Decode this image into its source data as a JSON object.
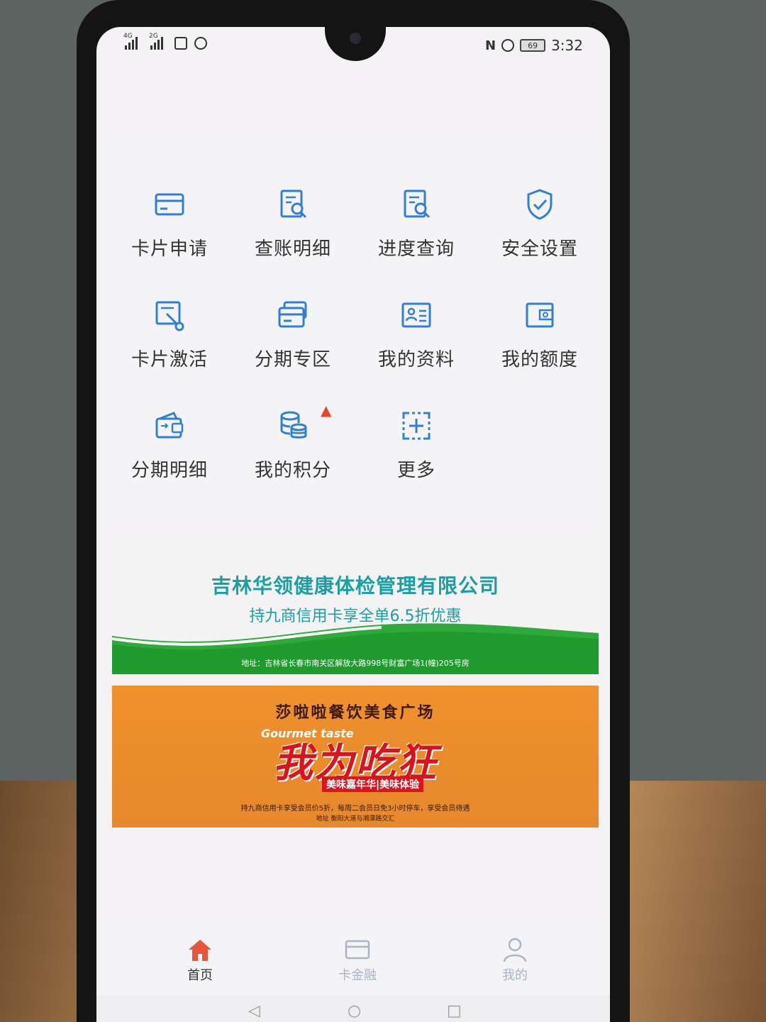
{
  "status_bar": {
    "signal1_tag": "4G",
    "signal2_tag": "2G",
    "battery": "69",
    "time": "3:32"
  },
  "menu": {
    "items": [
      {
        "label": "卡片申请",
        "icon": "card-icon"
      },
      {
        "label": "查账明细",
        "icon": "bill-search-icon"
      },
      {
        "label": "进度查询",
        "icon": "progress-search-icon"
      },
      {
        "label": "安全设置",
        "icon": "shield-check-icon"
      },
      {
        "label": "卡片激活",
        "icon": "card-activate-icon"
      },
      {
        "label": "分期专区",
        "icon": "installment-card-icon"
      },
      {
        "label": "我的资料",
        "icon": "profile-card-icon"
      },
      {
        "label": "我的额度",
        "icon": "wallet-icon"
      },
      {
        "label": "分期明细",
        "icon": "installment-wallet-icon"
      },
      {
        "label": "我的积分",
        "icon": "coins-icon"
      },
      {
        "label": "更多",
        "icon": "more-plus-icon"
      }
    ],
    "hot_badge": "fire-icon"
  },
  "banners": {
    "health": {
      "title": "吉林华领健康体检管理有限公司",
      "subtitle": "持九商信用卡享全单6.5折优惠",
      "address": "地址：吉林省长春市南关区解放大路998号财富广场1(幢)205号房"
    },
    "food": {
      "title": "莎啦啦餐饮美食广场",
      "english": "Gourmet taste",
      "headline": "我为吃狂",
      "tag": "美味嘉年华|美味体验",
      "description": "持九商信用卡享受会员价5折，每周二会员日免3小时停车，享受会员待遇",
      "address": "地址 衡阳大道与湘潭路交汇"
    }
  },
  "bottom_nav": {
    "items": [
      {
        "label": "首页",
        "icon": "home-icon",
        "active": true
      },
      {
        "label": "卡金融",
        "icon": "card-icon",
        "active": false
      },
      {
        "label": "我的",
        "icon": "user-icon",
        "active": false
      }
    ],
    "active_color": "#e8553a",
    "inactive_color": "#a9b4c6"
  },
  "colors": {
    "icon_blue": "#2f7fd8",
    "teal": "#1c9fa2",
    "green": "#2eaa3a",
    "orange": "#f0912c"
  }
}
